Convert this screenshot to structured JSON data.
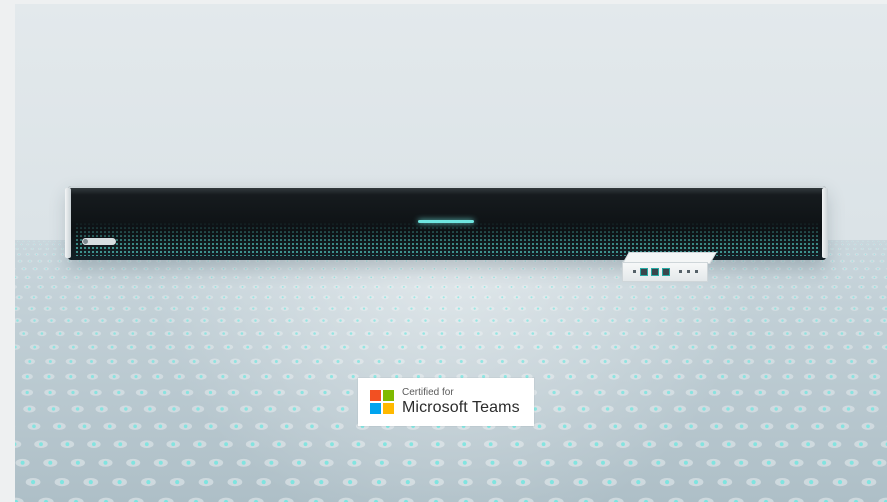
{
  "badge": {
    "line1": "Certified for",
    "line2": "Microsoft Teams",
    "logo_name": "microsoft-logo",
    "logo_colors": [
      "#f25022",
      "#7fba00",
      "#00a4ef",
      "#ffb900"
    ]
  },
  "colors": {
    "background": "#dbe3e7",
    "floor": "#c4d2d8",
    "led_glow": "#6fe6e0",
    "soundbar": "#0d1114"
  }
}
